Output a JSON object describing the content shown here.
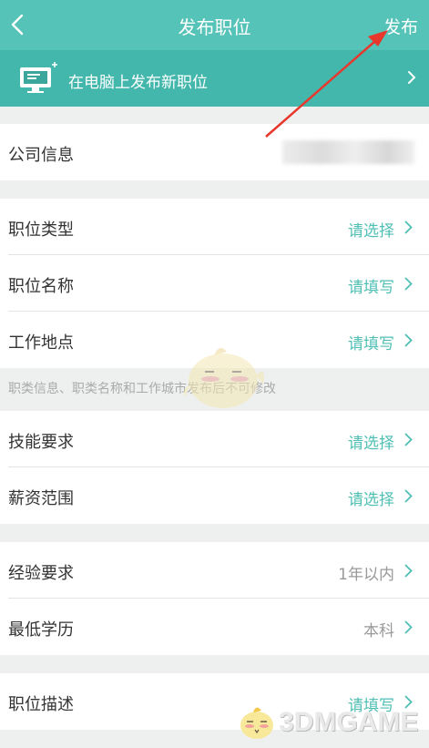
{
  "header": {
    "title": "发布职位",
    "publish_label": "发布"
  },
  "banner": {
    "text": "在电脑上发布新职位"
  },
  "company": {
    "label": "公司信息"
  },
  "group1": [
    {
      "label": "职位类型",
      "value": "请选择"
    },
    {
      "label": "职位名称",
      "value": "请填写"
    },
    {
      "label": "工作地点",
      "value": "请填写"
    }
  ],
  "note": "职类信息、职类名称和工作城市发布后不可修改",
  "group2": [
    {
      "label": "技能要求",
      "value": "请选择"
    },
    {
      "label": "薪资范围",
      "value": "请选择"
    }
  ],
  "group3": [
    {
      "label": "经验要求",
      "value": "1年以内"
    },
    {
      "label": "最低学历",
      "value": "本科"
    }
  ],
  "group4": [
    {
      "label": "职位描述",
      "value": "请填写"
    }
  ],
  "watermark": "3DMGAME",
  "colors": {
    "header": "#56c3b8",
    "banner": "#43b7ac",
    "accent": "#4fbfb4",
    "annotation": "#e8372c"
  }
}
